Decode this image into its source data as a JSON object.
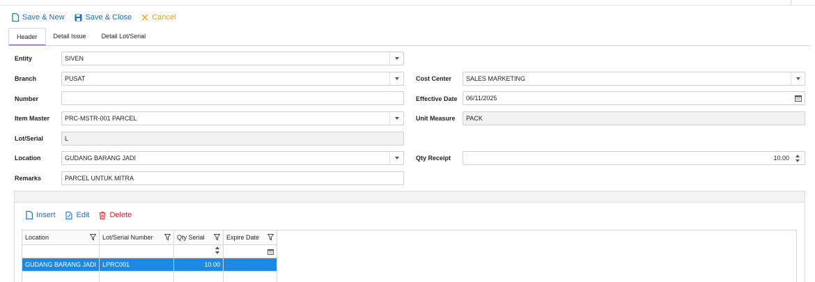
{
  "toolbar": {
    "save_new_label": "Save & New",
    "save_close_label": "Save & Close",
    "cancel_label": "Cancel"
  },
  "tabs": [
    {
      "label": "Header",
      "active": true
    },
    {
      "label": "Detail Issue",
      "active": false
    },
    {
      "label": "Detail Lot/Serial",
      "active": false
    }
  ],
  "form": {
    "entity": {
      "label": "Entity",
      "value": "SIVEN"
    },
    "branch": {
      "label": "Branch",
      "value": "PUSAT"
    },
    "number": {
      "label": "Number",
      "value": ""
    },
    "item_master": {
      "label": "Item Master",
      "value": "PRC-MSTR-001 PARCEL"
    },
    "lot_serial": {
      "label": "Lot/Serial",
      "value": "L"
    },
    "location": {
      "label": "Location",
      "value": "GUDANG BARANG JADI"
    },
    "remarks": {
      "label": "Remarks",
      "value": "PARCEL UNTUK MITRA"
    },
    "cost_center": {
      "label": "Cost Center",
      "value": "SALES MARKETING"
    },
    "effective_date": {
      "label": "Effective Date",
      "value": "06/11/2025"
    },
    "unit_measure": {
      "label": "Unit Measure",
      "value": "PACK"
    },
    "qty_receipt": {
      "label": "Qty Receipt",
      "value": "10.00"
    }
  },
  "grid_toolbar": {
    "insert_label": "Insert",
    "edit_label": "Edit",
    "delete_label": "Delete"
  },
  "grid": {
    "columns": [
      "Location",
      "Lot/Serial Number",
      "Qty Serial",
      "Expire Date"
    ],
    "rows": [
      {
        "location": "GUDANG BARANG JADI",
        "lot_serial_number": "LPRC001",
        "qty_serial": "10.00",
        "expire_date": ""
      }
    ]
  },
  "colors": {
    "accent": "#1a6fc7",
    "cancel": "#f0a000",
    "delete": "#d9232a",
    "tab_indicator": "#6c3cbd",
    "selected_row": "#1e88e5"
  }
}
